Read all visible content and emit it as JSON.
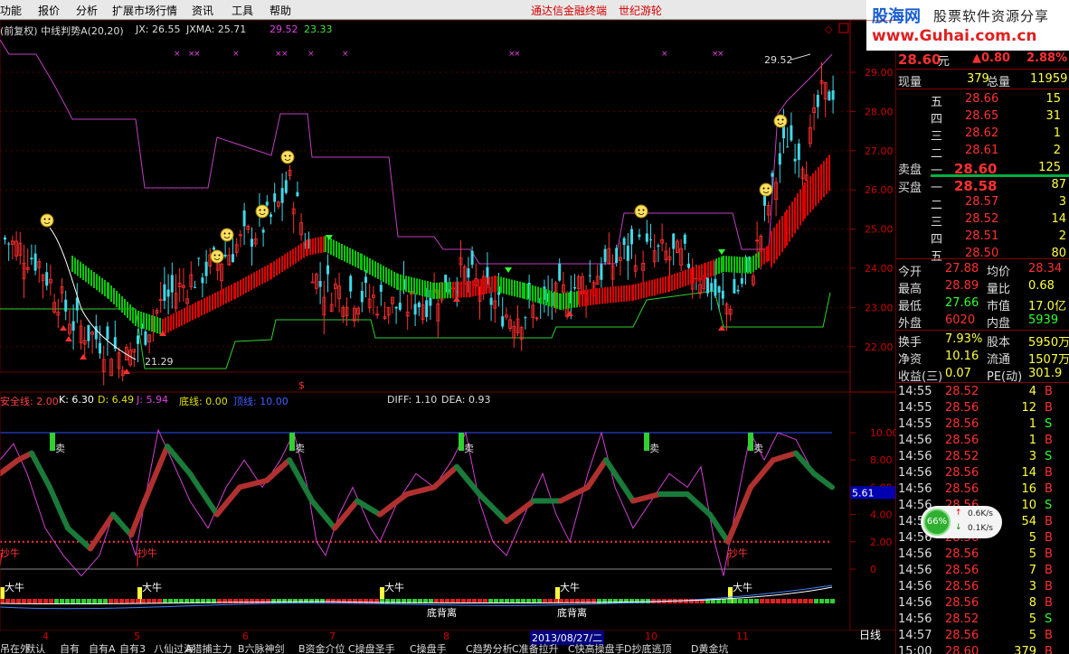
{
  "menu": [
    "功能",
    "报价",
    "分析",
    "扩展市场行情",
    "资讯",
    "工具",
    "帮助"
  ],
  "banner": {
    "broker": "通达信金融终端",
    "partner": "世纪游轮"
  },
  "brand": {
    "name": "股海网",
    "slogan": "股票软件资源分享",
    "url": "www.Guhai.com.cn"
  },
  "main_info": {
    "label": "(前复权) 中线判势A(20,20)",
    "jx_label": "JX: 26.55",
    "jxma_label": "JXMA: 25.71",
    "v1": "29.52",
    "v2": "23.33"
  },
  "price_axis": [
    "29.00",
    "28.00",
    "27.00",
    "26.00",
    "25.00",
    "24.00",
    "23.00",
    "22.00"
  ],
  "annotations": {
    "high": "29.52",
    "low": "21.29",
    "dollar": "$"
  },
  "sub_info": {
    "line1": "安全线: 2.00",
    "k": "K: 6.30",
    "d": "D: 6.49",
    "j": "J: 5.94",
    "bottom": "底线: 0.00",
    "top": "顶线: 10.00",
    "diff": "DIFF: 1.10",
    "dea": "DEA: 0.93"
  },
  "sub_axis": [
    "10.00",
    "8.00",
    "6.00",
    "4.00",
    "2.00",
    "0"
  ],
  "sub_current": "5.61",
  "signals": {
    "sell": "卖",
    "buy": "抄牛",
    "bull": "大牛",
    "divergence": "底背离"
  },
  "x_labels": [
    "4",
    "5",
    "6",
    "7",
    "8",
    "2013/08/27/二",
    "10",
    "11"
  ],
  "bottom_tabs": [
    "日线",
    "吊在外",
    "默认",
    "自有",
    "自有A",
    "自有3",
    "八仙过海",
    "A猎捕主力",
    "B六脉神剑",
    "B资金介位",
    "C操盘圣手",
    "C操盘手",
    "C趋势分析",
    "C准备拉升",
    "C快高操盘手",
    "D抄底逃顶",
    "D黄金坑"
  ],
  "quote": {
    "price": "28.60",
    "unit": "元",
    "change": "▲0.80",
    "pct": "2.88%",
    "now_vol_label": "现量",
    "now_vol": "379",
    "total_vol_label": "总量",
    "total_vol": "11959",
    "sell": [
      {
        "lvl": "五",
        "p": "28.66",
        "v": "15"
      },
      {
        "lvl": "四",
        "p": "28.65",
        "v": "31"
      },
      {
        "lvl": "三",
        "p": "28.62",
        "v": "1"
      },
      {
        "lvl": "二",
        "p": "28.61",
        "v": "2"
      },
      {
        "lvl": "一",
        "p": "28.60",
        "v": "125"
      }
    ],
    "sell_label": "卖盘",
    "buy": [
      {
        "lvl": "一",
        "p": "28.58",
        "v": "87"
      },
      {
        "lvl": "二",
        "p": "28.57",
        "v": "3"
      },
      {
        "lvl": "三",
        "p": "28.52",
        "v": "14"
      },
      {
        "lvl": "四",
        "p": "28.51",
        "v": "2"
      },
      {
        "lvl": "五",
        "p": "28.50",
        "v": "80"
      }
    ],
    "buy_label": "买盘",
    "stats": [
      {
        "a": "今开",
        "av": "27.88",
        "b": "均价",
        "bv": "28.34"
      },
      {
        "a": "最高",
        "av": "28.89",
        "b": "量比",
        "bv": "0.68"
      },
      {
        "a": "最低",
        "av": "27.66",
        "b": "市值",
        "bv": "17.0亿"
      },
      {
        "a": "外盘",
        "av": "6020",
        "b": "内盘",
        "bv": "5939"
      }
    ],
    "stats2": [
      {
        "a": "换手",
        "av": "7.93%",
        "b": "股本",
        "bv": "5950万"
      },
      {
        "a": "净资",
        "av": "10.16",
        "b": "流通",
        "bv": "1507万"
      },
      {
        "a": "收益(三)",
        "av": "0.07",
        "b": "PE(动)",
        "bv": "301.9"
      }
    ]
  },
  "ticks": [
    {
      "t": "14:55",
      "p": "28.52",
      "v": "4",
      "s": "B"
    },
    {
      "t": "14:55",
      "p": "28.56",
      "v": "12",
      "s": "B"
    },
    {
      "t": "14:55",
      "p": "28.56",
      "v": "1",
      "s": "S"
    },
    {
      "t": "14:56",
      "p": "28.56",
      "v": "1",
      "s": "B"
    },
    {
      "t": "14:56",
      "p": "28.52",
      "v": "3",
      "s": "S"
    },
    {
      "t": "14:56",
      "p": "28.56",
      "v": "14",
      "s": "B"
    },
    {
      "t": "14:56",
      "p": "28.56",
      "v": "16",
      "s": "B"
    },
    {
      "t": "14:56",
      "p": "28.56",
      "v": "10",
      "s": "S"
    },
    {
      "t": "14:56",
      "p": "28.56",
      "v": "54",
      "s": "B"
    },
    {
      "t": "14:56",
      "p": "28.56",
      "v": "5",
      "s": "B"
    },
    {
      "t": "14:56",
      "p": "28.56",
      "v": "5",
      "s": "B"
    },
    {
      "t": "14:56",
      "p": "28.56",
      "v": "7",
      "s": "B"
    },
    {
      "t": "14:56",
      "p": "28.56",
      "v": "3",
      "s": "B"
    },
    {
      "t": "14:56",
      "p": "28.56",
      "v": "8",
      "s": "B"
    },
    {
      "t": "14:56",
      "p": "28.52",
      "v": "5",
      "s": "S"
    },
    {
      "t": "14:57",
      "p": "28.56",
      "v": "5",
      "s": "B"
    },
    {
      "t": "15:00",
      "p": "28.60",
      "v": "379",
      "s": "B"
    }
  ],
  "speed": {
    "pct": "66%",
    "up": "0.6K/s",
    "down": "0.1K/s"
  },
  "colors": {
    "up": "#ff3030",
    "down": "#00e0e0",
    "ma_red": "#e00000",
    "ma_green": "#00d000",
    "band": "#c040c0"
  }
}
